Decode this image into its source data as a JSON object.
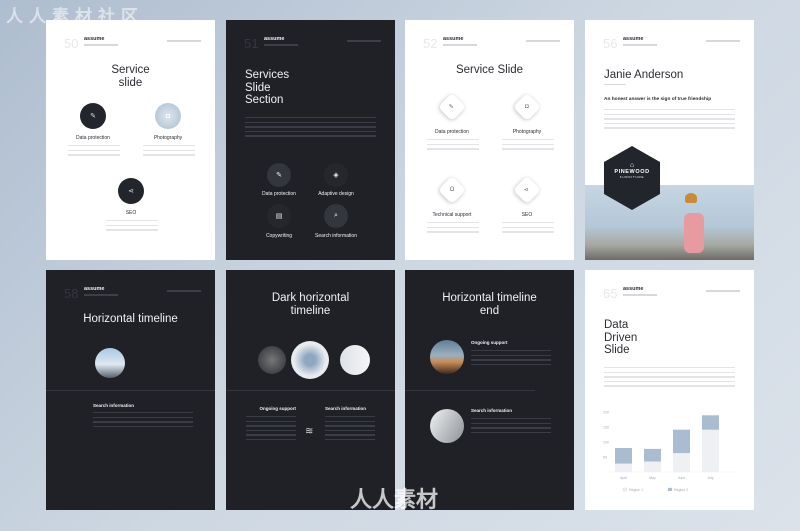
{
  "watermark": {
    "top": "人人素材社区",
    "bottom": "人人素材"
  },
  "colors": {
    "background": "#c4cfdb",
    "dark_slide": "#1f2127",
    "light_slide": "#ffffff",
    "chart_region2": "#a9bcd0",
    "chart_region1": "#eef0f3"
  },
  "slides": [
    {
      "number": "50",
      "brand": "assume",
      "title": "Service slide",
      "services": [
        {
          "label": "Data protection",
          "icon": "pen-icon"
        },
        {
          "label": "Photography",
          "icon": "camera-icon"
        },
        {
          "label": "SEO",
          "icon": "share-icon"
        }
      ]
    },
    {
      "number": "51",
      "brand": "assume",
      "title_lines": [
        "Services",
        "Slide",
        "Section"
      ],
      "services": [
        {
          "label": "Data protection",
          "icon": "pen-icon"
        },
        {
          "label": "Adaptive design",
          "icon": "layers-icon"
        },
        {
          "label": "Copywriting",
          "icon": "document-icon"
        },
        {
          "label": "Search information",
          "icon": "search-icon"
        }
      ]
    },
    {
      "number": "52",
      "brand": "assume",
      "title": "Service Slide",
      "services": [
        {
          "label": "Data protection",
          "icon": "pen-icon"
        },
        {
          "label": "Photography",
          "icon": "camera-icon"
        },
        {
          "label": "Technical support",
          "icon": "headset-icon"
        },
        {
          "label": "SEO",
          "icon": "share-icon"
        }
      ]
    },
    {
      "number": "56",
      "brand": "assume",
      "title": "Janie Anderson",
      "quote": "An honest answer is the sign of true friendship",
      "logo": {
        "name": "PINEWOOD",
        "sub": "FURNITURE"
      }
    },
    {
      "number": "58",
      "brand": "assume",
      "title": "Horizontal timeline",
      "item": "Search information"
    },
    {
      "title_lines": [
        "Dark horizontal",
        "timeline"
      ],
      "items": [
        "Ongoing support",
        "Search information"
      ]
    },
    {
      "title_lines": [
        "Horizontal timeline",
        "end"
      ],
      "items": [
        "Ongoing support",
        "Search information"
      ]
    },
    {
      "number": "65",
      "brand": "assume",
      "title_lines": [
        "Data",
        "Driven",
        "Slide"
      ]
    }
  ],
  "chart_data": {
    "type": "bar",
    "stacked": true,
    "categories": [
      "April",
      "May",
      "June",
      "July"
    ],
    "series": [
      {
        "name": "Region 1",
        "values": [
          28,
          35,
          63,
          141
        ]
      },
      {
        "name": "Region 2",
        "values": [
          52,
          42,
          78,
          48
        ]
      }
    ],
    "yticks": [
      "50",
      "100",
      "150",
      "200"
    ],
    "ylim": [
      0,
      200
    ],
    "grid": false,
    "legend": "bottom"
  }
}
